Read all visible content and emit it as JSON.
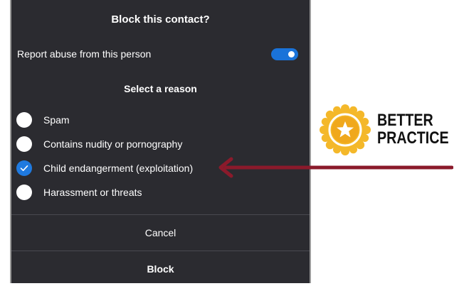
{
  "dialog": {
    "title": "Block this contact?",
    "report_label": "Report abuse from this person",
    "report_enabled": true,
    "section_heading": "Select a reason",
    "reasons": [
      {
        "label": "Spam",
        "selected": false
      },
      {
        "label": "Contains nudity or pornography",
        "selected": false
      },
      {
        "label": "Child endangerment (exploitation)",
        "selected": true
      },
      {
        "label": "Harassment or threats",
        "selected": false
      }
    ],
    "cancel_label": "Cancel",
    "block_label": "Block"
  },
  "annotation": {
    "line1": "BETTER",
    "line2": "PRACTICE",
    "badge_icon": "star-icon",
    "arrow_icon": "arrow-left-icon"
  },
  "colors": {
    "dialog_bg": "#2b2b30",
    "accent": "#1f7ae0",
    "arrow": "#8b1a2b",
    "badge_gold": "#f4b82a"
  }
}
